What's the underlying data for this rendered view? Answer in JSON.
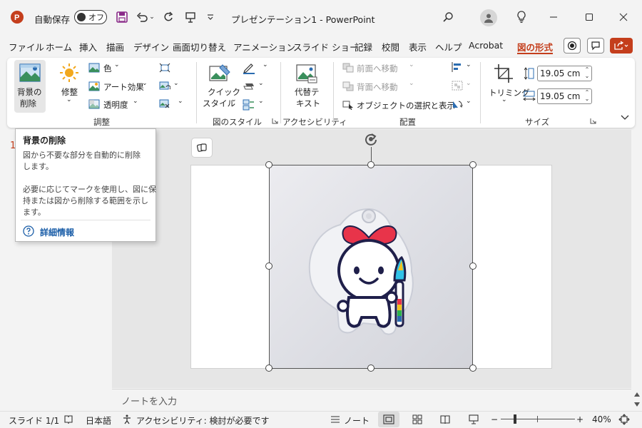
{
  "titlebar": {
    "autosave_label": "自動保存",
    "autosave_state": "オフ",
    "document_title": "プレゼンテーション1 - PowerPoint",
    "app_accent": "#c43e1c"
  },
  "tabs": [
    {
      "label": "ファイル"
    },
    {
      "label": "ホーム"
    },
    {
      "label": "挿入"
    },
    {
      "label": "描画"
    },
    {
      "label": "デザイン"
    },
    {
      "label": "画面切り替え"
    },
    {
      "label": "アニメーション"
    },
    {
      "label": "スライド ショー"
    },
    {
      "label": "記録"
    },
    {
      "label": "校閲"
    },
    {
      "label": "表示"
    },
    {
      "label": "ヘルプ"
    },
    {
      "label": "Acrobat"
    },
    {
      "label": "図の形式",
      "active": true
    }
  ],
  "ribbon": {
    "remove_bg_line1": "背景の",
    "remove_bg_line2": "削除",
    "corrections": "修整",
    "color": "色",
    "artistic": "アート効果",
    "transparency": "透明度",
    "group_adjust": "調整",
    "quick_styles_line1": "クイック",
    "quick_styles_line2": "スタイル",
    "group_styles": "図のスタイル",
    "alt_text_line1": "代替テ",
    "alt_text_line2": "キスト",
    "group_accessibility": "アクセシビリティ",
    "bring_forward": "前面へ移動",
    "send_backward": "背面へ移動",
    "selection_pane": "オブジェクトの選択と表示",
    "group_arrange": "配置",
    "crop": "トリミング",
    "height_value": "19.05 cm",
    "width_value": "19.05 cm",
    "group_size": "サイズ"
  },
  "tooltip": {
    "title": "背景の削除",
    "body1_line1": "図から不要な部分を自動的に削除",
    "body1_line2": "します。",
    "body2_line1": "必要に応じてマークを使用し、図に保",
    "body2_line2": "持または図から削除する範囲を示し",
    "body2_line3": "ます。",
    "link": "詳細情報"
  },
  "slide_thumb_number": "1",
  "notes_placeholder": "ノートを入力",
  "statusbar": {
    "slide": "スライド 1/1",
    "language": "日本語",
    "accessibility": "アクセシビリティ: 検討が必要です",
    "notes": "ノート",
    "zoom": "40%"
  }
}
